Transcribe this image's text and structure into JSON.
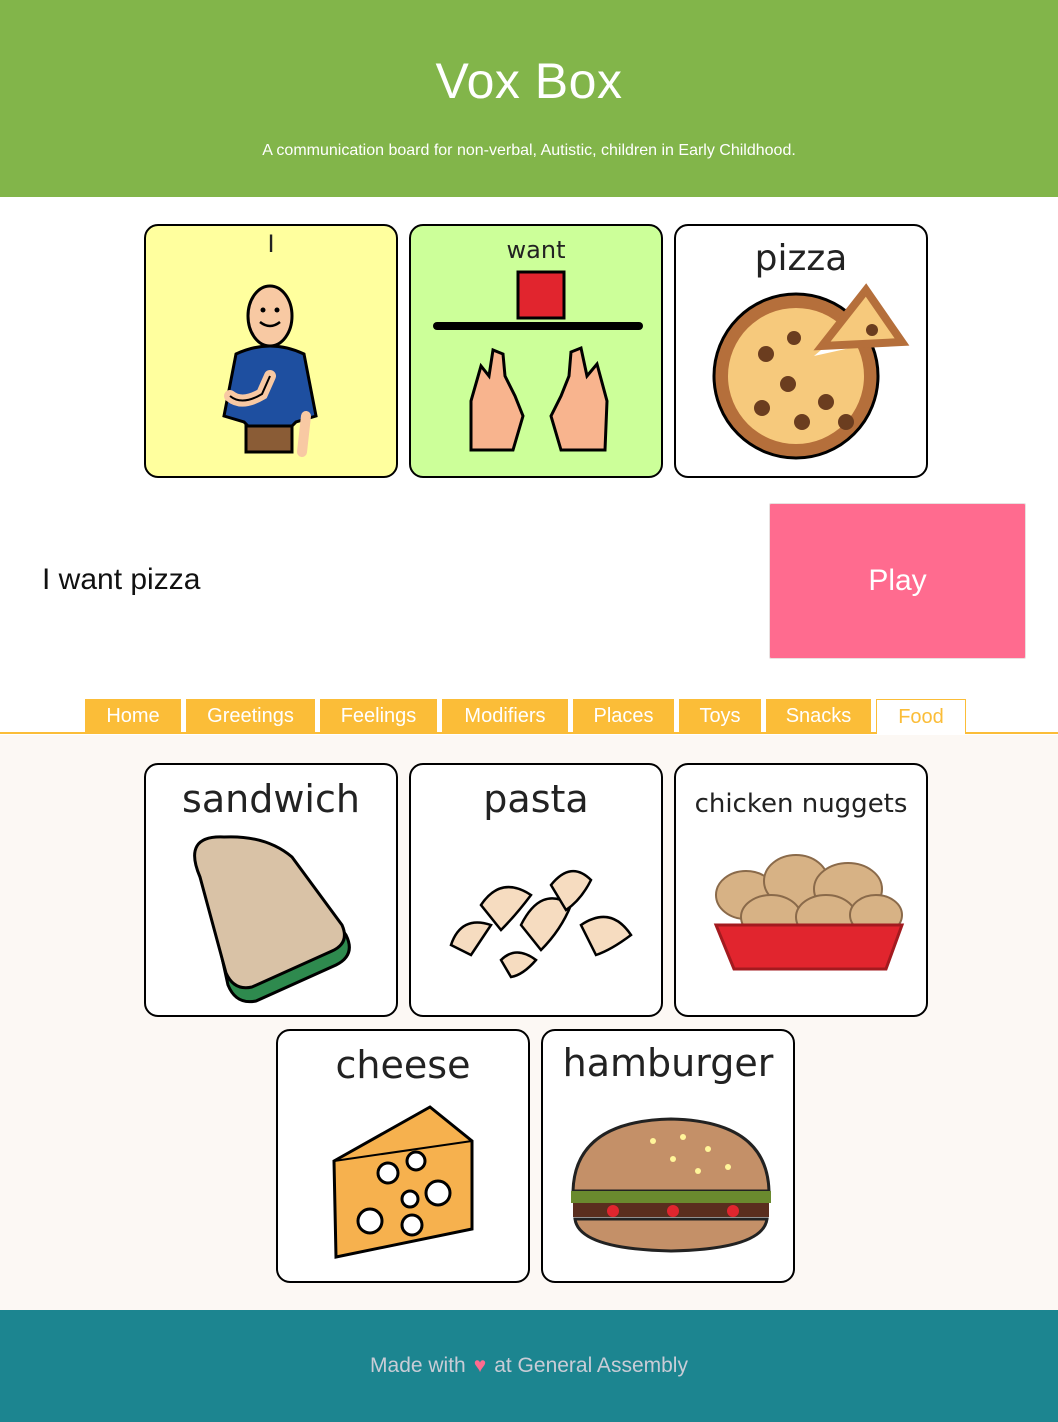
{
  "header": {
    "title": "Vox Box",
    "subtitle": "A communication board for non-verbal, Autistic, children in Early Childhood."
  },
  "selected_cards": [
    {
      "label": "I",
      "icon": "person-pointing-self-icon",
      "bg": "#ffff9e"
    },
    {
      "label": "want",
      "icon": "want-hands-icon",
      "bg": "#ccff99"
    },
    {
      "label": "pizza",
      "icon": "pizza-icon",
      "bg": "#ffffff"
    }
  ],
  "sentence": "I want pizza",
  "play_label": "Play",
  "tabs": [
    {
      "label": "Home"
    },
    {
      "label": "Greetings"
    },
    {
      "label": "Feelings"
    },
    {
      "label": "Modifiers"
    },
    {
      "label": "Places"
    },
    {
      "label": "Toys"
    },
    {
      "label": "Snacks"
    },
    {
      "label": "Food",
      "active": true
    }
  ],
  "food_cards": [
    {
      "label": "sandwich",
      "icon": "sandwich-icon"
    },
    {
      "label": "pasta",
      "icon": "pasta-icon"
    },
    {
      "label": "chicken nuggets",
      "icon": "chicken-nuggets-icon"
    },
    {
      "label": "cheese",
      "icon": "cheese-icon"
    },
    {
      "label": "hamburger",
      "icon": "hamburger-icon"
    }
  ],
  "footer": {
    "before": "Made with",
    "heart": "♥",
    "after": "at General Assembly"
  },
  "colors": {
    "header": "#82b54a",
    "play": "#ff6b8f",
    "tab": "#fbbd38",
    "footer": "#1c8590"
  }
}
